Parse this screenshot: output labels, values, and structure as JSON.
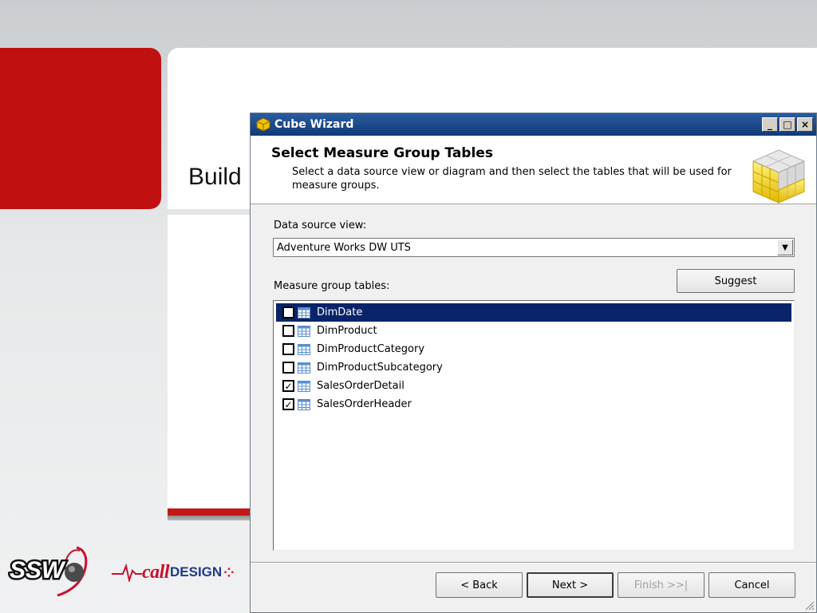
{
  "slide": {
    "visible_text": "Build",
    "logos": {
      "ssw": "SSW",
      "call": "call",
      "design": "DESIGN"
    }
  },
  "window": {
    "title": "Cube Wizard",
    "controls": {
      "minimize": "_",
      "maximize": "□",
      "close": "×"
    }
  },
  "header": {
    "title": "Select Measure Group Tables",
    "description": "Select a data source view or diagram and then select the tables that will be used for measure groups."
  },
  "data_source_view": {
    "label": "Data source view:",
    "value": "Adventure Works DW UTS"
  },
  "measure_group_tables": {
    "label": "Measure group tables:",
    "suggest_label": "Suggest",
    "items": [
      {
        "label": "DimDate",
        "checked": false,
        "selected": true
      },
      {
        "label": "DimProduct",
        "checked": false,
        "selected": false
      },
      {
        "label": "DimProductCategory",
        "checked": false,
        "selected": false
      },
      {
        "label": "DimProductSubcategory",
        "checked": false,
        "selected": false
      },
      {
        "label": "SalesOrderDetail",
        "checked": true,
        "selected": false
      },
      {
        "label": "SalesOrderHeader",
        "checked": true,
        "selected": false
      }
    ]
  },
  "buttons": {
    "back": "< Back",
    "next": "Next >",
    "finish": "Finish >>|",
    "cancel": "Cancel"
  }
}
